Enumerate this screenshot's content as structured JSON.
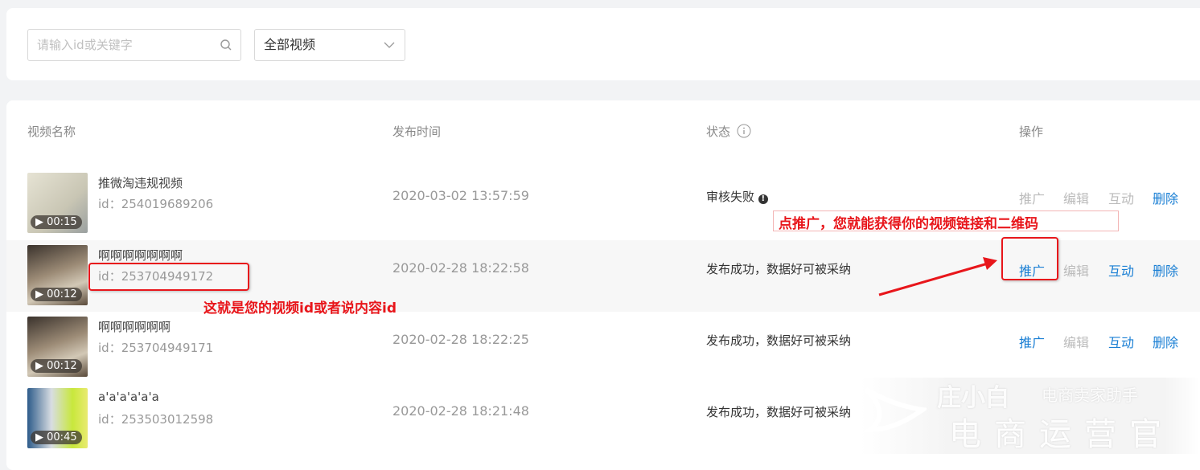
{
  "filter": {
    "search_placeholder": "请输入id或关键字",
    "select_value": "全部视频"
  },
  "table": {
    "headers": {
      "name": "视频名称",
      "time": "发布时间",
      "status": "状态",
      "ops": "操作"
    },
    "rows": [
      {
        "title": "推微淘违规视频",
        "id": "id：254019689206",
        "duration": "00:15",
        "time": "2020-03-02 13:57:59",
        "status": "审核失败",
        "ops": [
          "推广",
          "编辑",
          "互动",
          "删除"
        ]
      },
      {
        "title": "啊啊啊啊啊啊啊",
        "id": "id：253704949172",
        "duration": "00:12",
        "time": "2020-02-28 18:22:58",
        "status": "发布成功，数据好可被采纳",
        "ops": [
          "推广",
          "编辑",
          "互动",
          "删除"
        ]
      },
      {
        "title": "啊啊啊啊啊啊",
        "id": "id：253704949171",
        "duration": "00:12",
        "time": "2020-02-28 18:22:25",
        "status": "发布成功，数据好可被采纳",
        "ops": [
          "推广",
          "编辑",
          "互动",
          "删除"
        ]
      },
      {
        "title": "a'a'a'a'a'a",
        "id": "id：253503012598",
        "duration": "00:45",
        "time": "2020-02-28 18:21:48",
        "status": "发布成功，数据好可被采纳"
      }
    ]
  },
  "annotations": {
    "promote_note": "点推广，您就能获得你的视频链接和二维码",
    "id_note": "这就是您的视频id或者说内容id"
  },
  "watermark": {
    "brand": "庄小白",
    "tagline": "电商卖家助手",
    "calligraphy": "电商运营官"
  },
  "colors": {
    "link": "#1a7fd4",
    "annotation": "#e8161b"
  }
}
